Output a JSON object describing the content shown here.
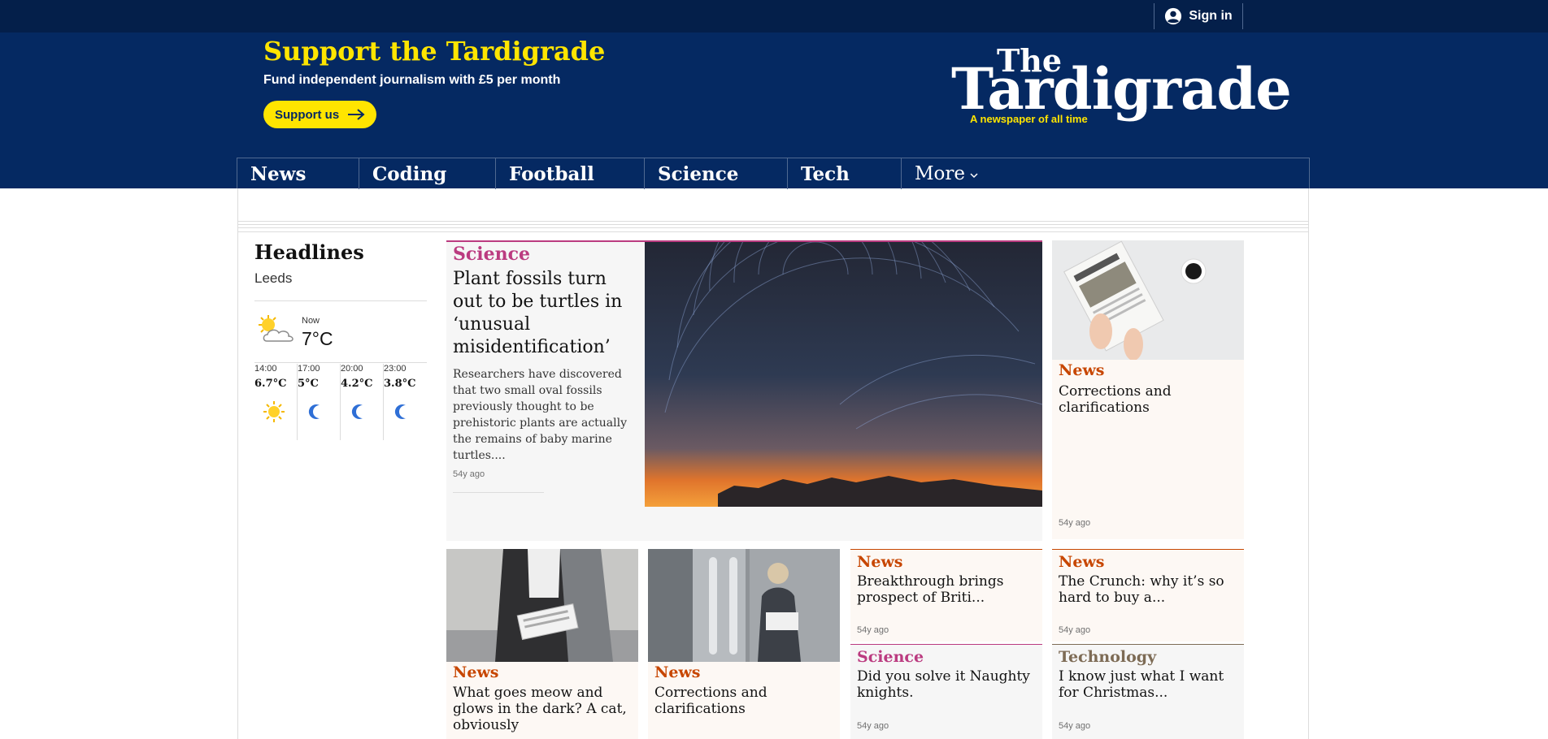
{
  "topbar": {
    "signin_label": "Sign in",
    "signin_icon": "user-avatar-icon"
  },
  "support": {
    "title": "Support the Tardigrade",
    "subtitle": "Fund independent journalism with £5 per month",
    "button_label": "Support us",
    "button_icon": "arrow-right-icon"
  },
  "logo": {
    "the": "The",
    "name": "Tardigrade",
    "tagline": "A newspaper of all time"
  },
  "nav": {
    "items": [
      "News",
      "Coding",
      "Football",
      "Science",
      "Tech"
    ],
    "more_label": "More",
    "more_icon": "chevron-down-icon"
  },
  "headlines": {
    "title": "Headlines",
    "location": "Leeds",
    "weather": {
      "now_label": "Now",
      "now_temp": "7°C",
      "now_icon": "sun-cloud-icon",
      "forecast": [
        {
          "time": "14:00",
          "temp": "6.7°C",
          "icon": "sun-icon"
        },
        {
          "time": "17:00",
          "temp": "5°C",
          "icon": "moon-icon"
        },
        {
          "time": "20:00",
          "temp": "4.2°C",
          "icon": "moon-icon"
        },
        {
          "time": "23:00",
          "temp": "3.8°C",
          "icon": "moon-icon"
        }
      ]
    }
  },
  "featured": {
    "kicker": "Science",
    "title": "Plant fossils turn out to be turtles in ‘unusual misidentification’",
    "description": "Researchers have discovered that two small oval fossils previously thought to be prehistoric plants are actually the remains of baby marine turtles....",
    "time": "54y ago",
    "image": "star-trails-sunset-image"
  },
  "cards": [
    {
      "kicker": "News",
      "title": "Corrections and clarifications",
      "time": "54y ago",
      "image": "newspaper-coffee-image"
    },
    {
      "kicker": "News",
      "title": "What goes meow and glows in the dark? A cat, obviously",
      "image": "person-newspaper-image"
    },
    {
      "kicker": "News",
      "title": "Corrections and clarifications",
      "image": "train-reader-image"
    },
    {
      "kicker": "News",
      "title": "Breakthrough brings prospect of Briti...",
      "time": "54y ago"
    },
    {
      "kicker": "News",
      "title": "The Crunch: why it’s so hard to buy a...",
      "time": "54y ago"
    },
    {
      "kicker": "Science",
      "title": "Did you solve it Naughty knights.",
      "time": "54y ago"
    },
    {
      "kicker": "Technology",
      "title": "I know just what I want for Christmas...",
      "time": "54y ago"
    }
  ],
  "colors": {
    "brand_dark": "#041f4a",
    "brand": "#052962",
    "accent_yellow": "#ffe500",
    "news": "#c74600",
    "science": "#bb3b80",
    "technology": "#7d6b55"
  }
}
